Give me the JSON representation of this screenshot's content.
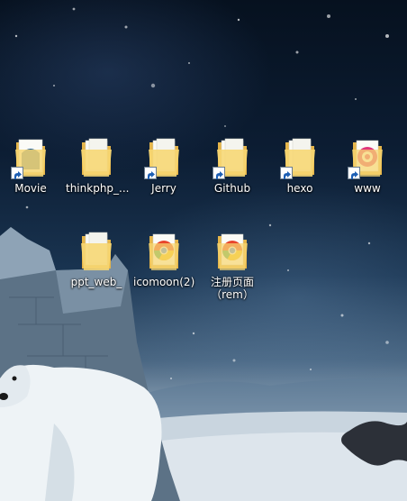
{
  "desktop": {
    "icons": [
      {
        "label": "Movie",
        "shortcut": true,
        "icon": "movie-folder-icon",
        "overlay": "#1d5b92"
      },
      {
        "label": "thinkphp_...",
        "shortcut": false,
        "icon": "folder-icon",
        "overlay": ""
      },
      {
        "label": "Jerry",
        "shortcut": true,
        "icon": "folder-icon",
        "overlay": ""
      },
      {
        "label": "Github",
        "shortcut": true,
        "icon": "folder-icon",
        "overlay": ""
      },
      {
        "label": "hexo",
        "shortcut": true,
        "icon": "folder-icon",
        "overlay": ""
      },
      {
        "label": "www",
        "shortcut": true,
        "icon": "www-folder-icon",
        "overlay": "#e0347a"
      },
      {
        "label": "ppt_web_",
        "shortcut": false,
        "icon": "folder-icon",
        "overlay": ""
      },
      {
        "label": "icomoon(2)",
        "shortcut": false,
        "icon": "chrome-folder-icon",
        "overlay": "#e8452c"
      },
      {
        "label": "注册页面（rem）",
        "shortcut": false,
        "icon": "chrome-folder-icon",
        "overlay": "#e8452c"
      }
    ]
  },
  "colors": {
    "folder_back": "#e5b54a",
    "folder_front": "#f7d773",
    "paper": "#fbfbf7"
  }
}
